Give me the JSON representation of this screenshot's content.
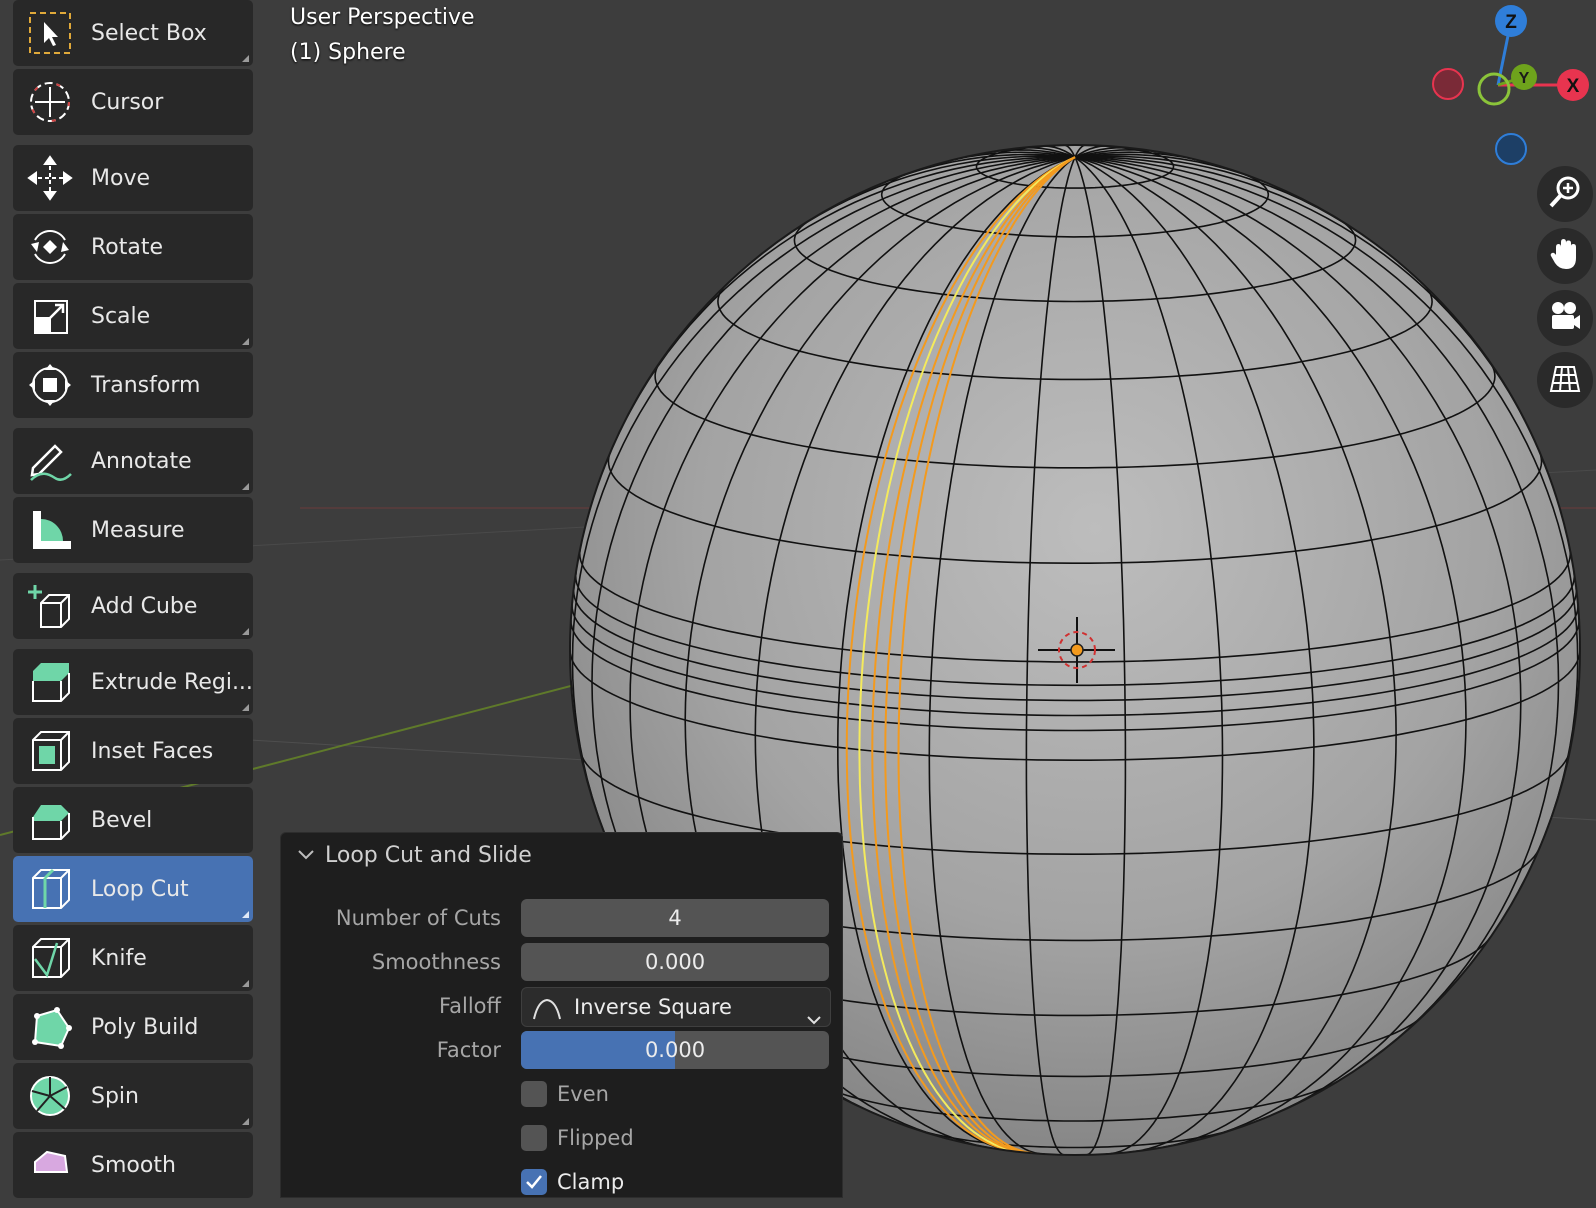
{
  "viewport": {
    "title": "User Perspective",
    "object_label": "(1) Sphere"
  },
  "toolbar": {
    "tools": [
      {
        "label": "Select Box",
        "icon": "select-box-icon"
      },
      {
        "label": "Cursor",
        "icon": "cursor-icon"
      },
      {
        "label": "Move",
        "icon": "move-icon"
      },
      {
        "label": "Rotate",
        "icon": "rotate-icon"
      },
      {
        "label": "Scale",
        "icon": "scale-icon"
      },
      {
        "label": "Transform",
        "icon": "transform-icon"
      },
      {
        "label": "Annotate",
        "icon": "annotate-icon"
      },
      {
        "label": "Measure",
        "icon": "measure-icon"
      },
      {
        "label": "Add Cube",
        "icon": "add-cube-icon"
      },
      {
        "label": "Extrude Regi...",
        "icon": "extrude-region-icon"
      },
      {
        "label": "Inset Faces",
        "icon": "inset-faces-icon"
      },
      {
        "label": "Bevel",
        "icon": "bevel-icon"
      },
      {
        "label": "Loop Cut",
        "icon": "loop-cut-icon",
        "active": true
      },
      {
        "label": "Knife",
        "icon": "knife-icon"
      },
      {
        "label": "Poly Build",
        "icon": "poly-build-icon"
      },
      {
        "label": "Spin",
        "icon": "spin-icon"
      },
      {
        "label": "Smooth",
        "icon": "smooth-icon"
      }
    ]
  },
  "gizmo": {
    "axes": {
      "z": "Z",
      "y": "Y",
      "x": "X"
    },
    "colors": {
      "x": "#e8344f",
      "y": "#6ea31c",
      "z": "#2f7ed9"
    }
  },
  "nav_buttons": [
    "zoom-icon",
    "hand-pan-icon",
    "camera-icon",
    "grid-icon"
  ],
  "operator_panel": {
    "title": "Loop Cut and Slide",
    "number_of_cuts": {
      "label": "Number of Cuts",
      "value": "4"
    },
    "smoothness": {
      "label": "Smoothness",
      "value": "0.000"
    },
    "falloff": {
      "label": "Falloff",
      "value": "Inverse Square"
    },
    "factor": {
      "label": "Factor",
      "value": "0.000",
      "fill_fraction": 0.5
    },
    "even": {
      "label": "Even",
      "checked": false
    },
    "flipped": {
      "label": "Flipped",
      "checked": false
    },
    "clamp": {
      "label": "Clamp",
      "checked": true
    }
  },
  "colors": {
    "accent": "#4772b3",
    "loop_edge_orange": "#f39a1e",
    "loop_edge_yellow": "#f4ea5c",
    "background": "#3d3d3d"
  }
}
